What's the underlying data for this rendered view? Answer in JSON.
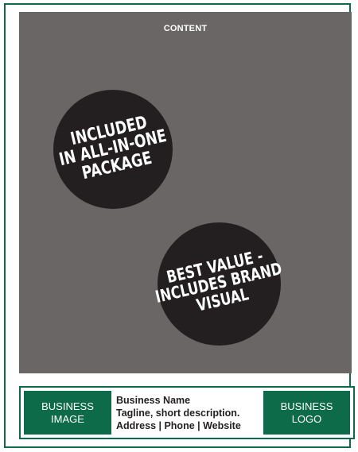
{
  "content": {
    "label": "CONTENT",
    "background_color": "#6b6666"
  },
  "badges": [
    {
      "lines": [
        "INCLUDED",
        "IN ALL-IN-ONE",
        "PACKAGE"
      ],
      "color": "#231f20"
    },
    {
      "lines": [
        "BEST VALUE -",
        "INCLUDES BRAND",
        "VISUAL"
      ],
      "color": "#231f20"
    }
  ],
  "footer": {
    "accent_color": "#0d6b4a",
    "image_label": [
      "BUSINESS",
      "IMAGE"
    ],
    "logo_label": [
      "BUSINESS",
      "LOGO"
    ],
    "business_name": "Business Name",
    "tagline": "Tagline, short description.",
    "contact": "Address | Phone | Website"
  }
}
